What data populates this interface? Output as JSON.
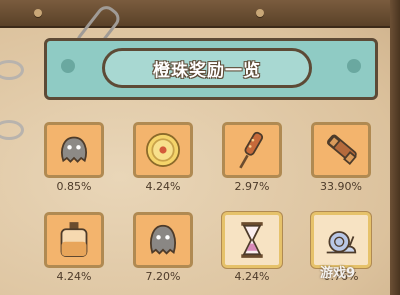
{
  "title": "橙珠奖励一览",
  "items": [
    {
      "name": "ghost-figure",
      "percent": "0.85%",
      "bg": "orange"
    },
    {
      "name": "gold-coin",
      "percent": "4.24%",
      "bg": "orange"
    },
    {
      "name": "stick-candy",
      "percent": "2.97%",
      "bg": "orange"
    },
    {
      "name": "telescope",
      "percent": "33.90%",
      "bg": "orange"
    },
    {
      "name": "perfume-bottle",
      "percent": "4.24%",
      "bg": "orange"
    },
    {
      "name": "ghost-figure-gray",
      "percent": "7.20%",
      "bg": "orange"
    },
    {
      "name": "hourglass",
      "percent": "4.24%",
      "bg": "cream"
    },
    {
      "name": "snail",
      "percent": "0.76%",
      "bg": "cream"
    }
  ],
  "watermark": "游戏9",
  "colors": {
    "panel": "#8fcbc4",
    "orange_tile": "#f3b46d",
    "cream_tile": "#f7e3c3",
    "frame": "#5d4a36"
  }
}
